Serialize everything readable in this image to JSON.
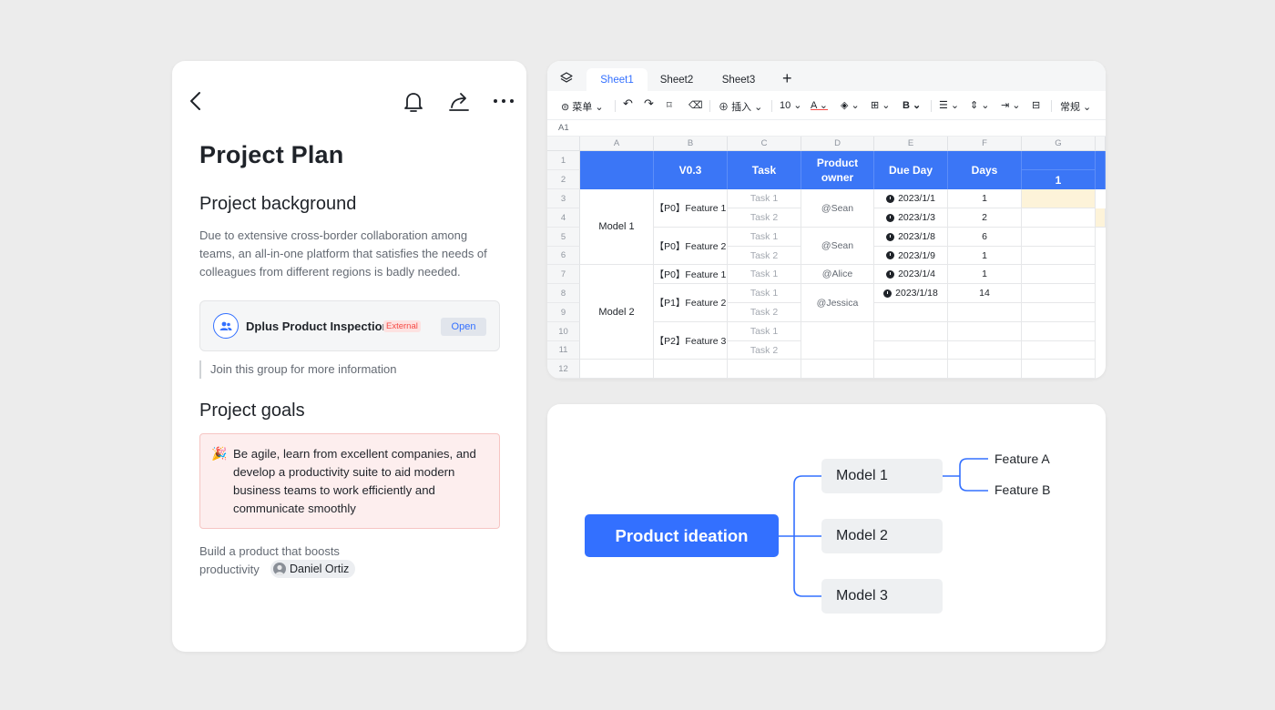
{
  "doc": {
    "title": "Project Plan",
    "background_heading": "Project background",
    "background_text": "Due to extensive cross-border collaboration among teams, an all-in-one platform that satisfies the needs of colleagues from different regions is badly needed.",
    "group": {
      "name": "Dplus Product Inspection",
      "badge": "External",
      "open_label": "Open"
    },
    "join_text": "Join this group for more information",
    "goals_heading": "Project goals",
    "goal_emoji": "🎉",
    "goal_text": "Be agile, learn from excellent companies, and develop a productivity suite to aid modern business teams to work efficiently and communicate smoothly",
    "build_text": "Build a product that boosts productivity",
    "mention_name": "Daniel Ortiz"
  },
  "sheet": {
    "tabs": [
      "Sheet1",
      "Sheet2",
      "Sheet3"
    ],
    "add_tab": "+",
    "toolbar": {
      "menu": "菜单",
      "insert": "插入",
      "font_size": "10",
      "format": "常规"
    },
    "cell_ref": "A1",
    "columns": [
      "A",
      "B",
      "C",
      "D",
      "E",
      "F",
      "G"
    ],
    "rows": [
      "1",
      "2",
      "3",
      "4",
      "5",
      "6",
      "7",
      "8",
      "9",
      "10",
      "11",
      "12"
    ],
    "header": {
      "version": "V0.3",
      "task": "Task",
      "owner": "Product owner",
      "due": "Due Day",
      "days": "Days",
      "g_value": "1"
    },
    "models": [
      "Model 1",
      "Model 2"
    ],
    "features": [
      "【P0】Feature 1",
      "【P0】Feature 2",
      "【P0】Feature 1",
      "【P1】Feature 2",
      "【P2】Feature 3"
    ],
    "tasks": [
      "Task 1",
      "Task 2",
      "Task 1",
      "Task 2",
      "Task 1",
      "Task 1",
      "Task 2",
      "Task 1",
      "Task 2"
    ],
    "owners": [
      "@Sean",
      "@Sean",
      "@Alice",
      "@Jessica"
    ],
    "due_dates": [
      "2023/1/1",
      "2023/1/3",
      "2023/1/8",
      "2023/1/9",
      "2023/1/4",
      "2023/1/18"
    ],
    "days": [
      "1",
      "2",
      "6",
      "1",
      "1",
      "14"
    ]
  },
  "mindmap": {
    "root": "Product ideation",
    "models": [
      "Model 1",
      "Model 2",
      "Model 3"
    ],
    "features": [
      "Feature A",
      "Feature B"
    ],
    "line_color": "#3370ff"
  },
  "colors": {
    "accent": "#3370ff",
    "header_blue": "#3b76f6",
    "goal_bg": "#fdeeee",
    "external_red": "#f54a45",
    "highlight_cell": "#fdf3d9"
  }
}
